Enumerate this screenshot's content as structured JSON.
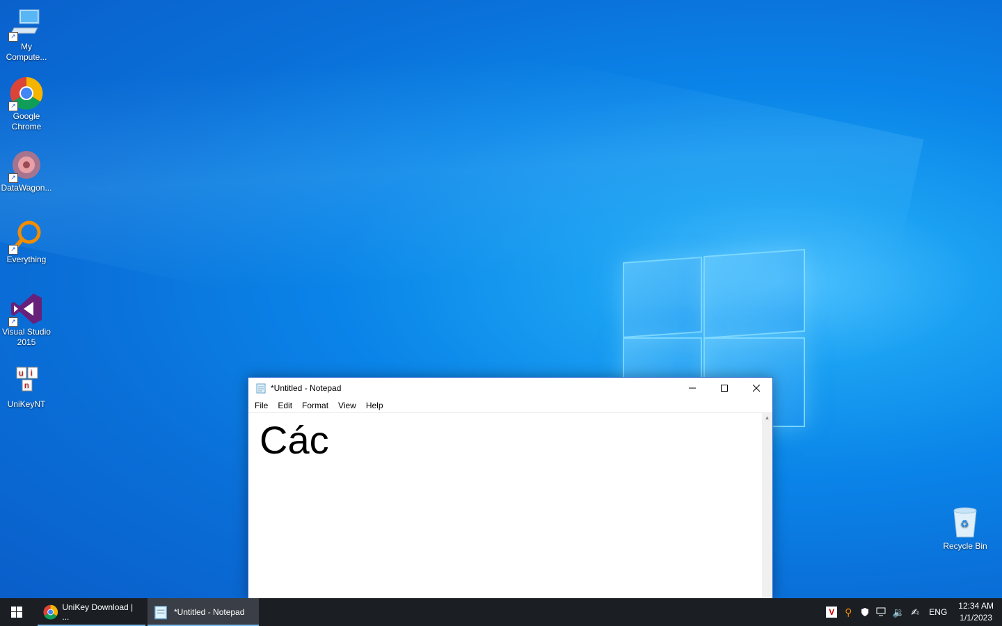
{
  "desktop": {
    "icons": [
      {
        "label": "My\nCompute..."
      },
      {
        "label": "Google\nChrome"
      },
      {
        "label": "DataWagon..."
      },
      {
        "label": "Everything"
      },
      {
        "label": "Visual Studio\n2015"
      },
      {
        "label": "UniKeyNT"
      },
      {
        "label": "Recycle Bin"
      }
    ]
  },
  "notepad": {
    "title": "*Untitled - Notepad",
    "menu": [
      "File",
      "Edit",
      "Format",
      "View",
      "Help"
    ],
    "content": "Các"
  },
  "taskbar": {
    "items": [
      {
        "label": "UniKey Download | ..."
      },
      {
        "label": "*Untitled - Notepad"
      }
    ],
    "language": "ENG",
    "time": "12:34 AM",
    "date": "1/1/2023"
  },
  "colors": {
    "accent": "#0a84e8",
    "taskbar": "#1b1f24"
  }
}
